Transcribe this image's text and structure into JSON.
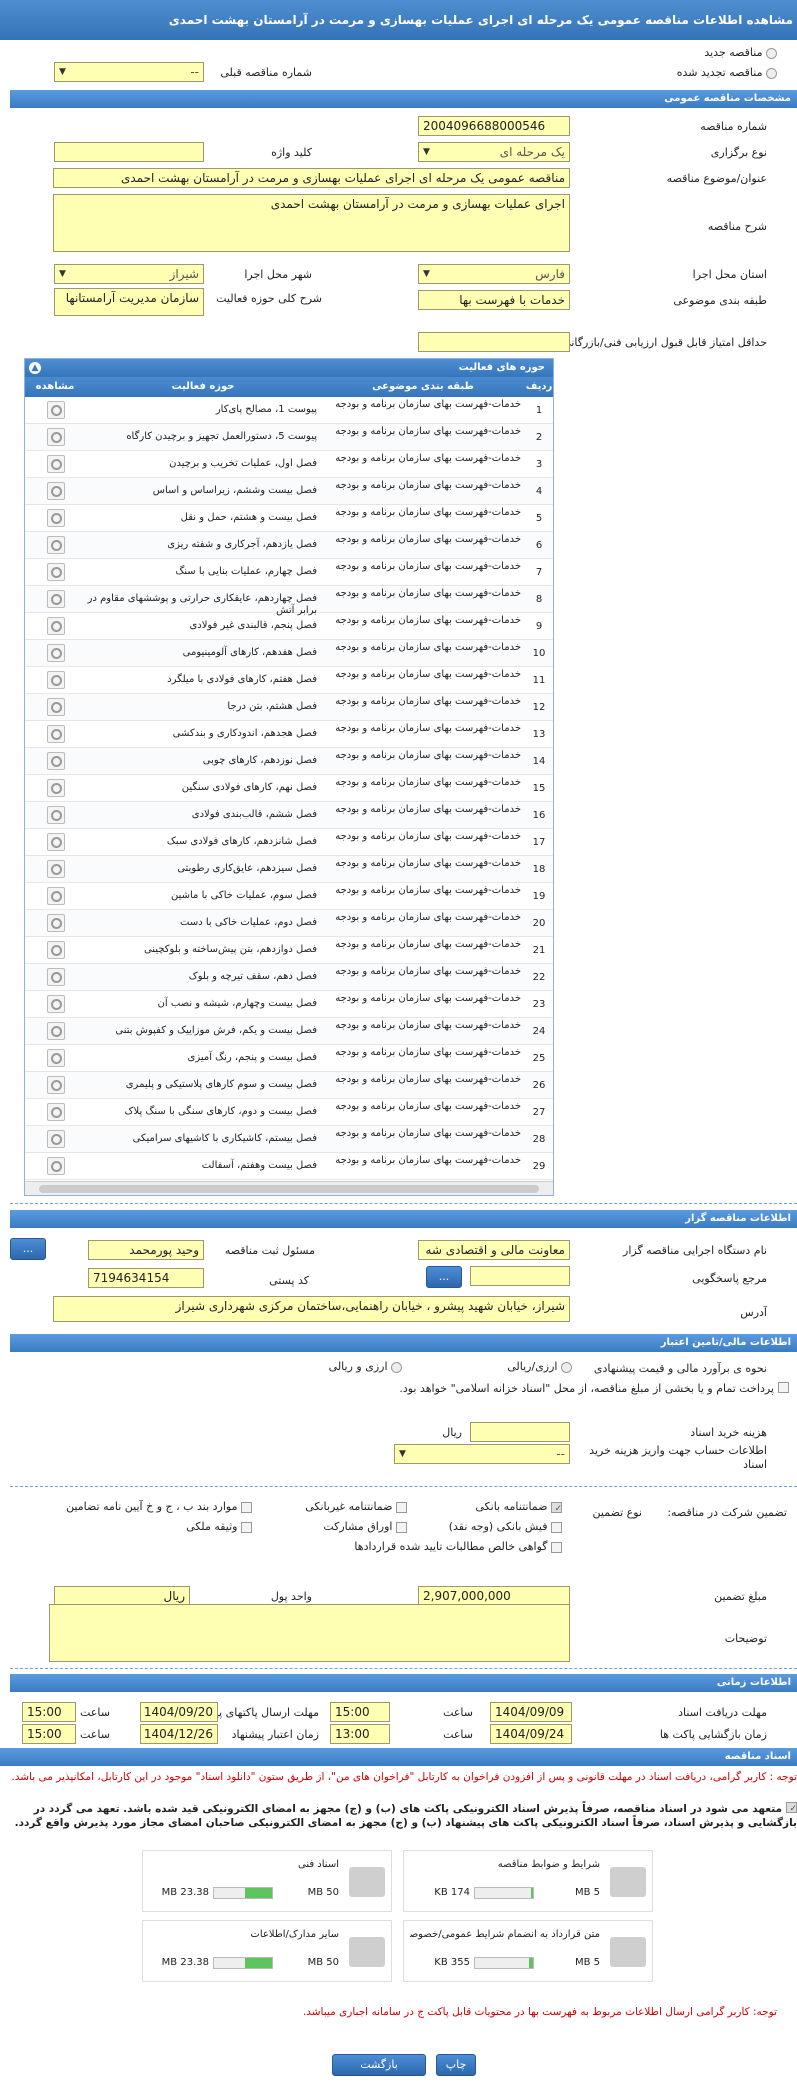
{
  "title": "مشاهده اطلاعات مناقصه عمومی یک مرحله ای اجرای عملیات بهسازی و مرمت در آرامستان بهشت احمدی",
  "top": {
    "new_tender": "مناقصه جدید",
    "renewed_tender": "مناقصه تجدید شده",
    "prev_number_label": "شماره مناقصه قبلی",
    "prev_number_value": "--"
  },
  "general": {
    "header": "مشخصات مناقصه عمومی",
    "number_label": "شماره مناقصه",
    "number_value": "2004096688000546",
    "type_label": "نوع برگزاری",
    "type_value": "یک مرحله ای",
    "keyword_label": "کلید واژه",
    "keyword_value": "",
    "subject_label": "عنوان/موضوع مناقصه",
    "subject_value": "مناقصه عمومی یک مرحله ای اجرای عملیات بهسازی و مرمت در آرامستان بهشت احمدی",
    "desc_label": "شرح مناقصه",
    "desc_value": "اجرای عملیات بهسازی و مرمت در آرامستان بهشت احمدی",
    "province_label": "استان محل اجرا",
    "province_value": "فارس",
    "city_label": "شهر محل اجرا",
    "city_value": "شیراز",
    "category_label": "طبقه بندی موضوعی",
    "category_value": "خدمات با فهرست بها",
    "activity_desc_label": "شرح کلی حوزه فعالیت",
    "activity_desc_value": "سازمان مدیریت آرامستانها",
    "min_score_label": "حداقل امتیاز قابل قبول ارزیابی فنی/بازرگانی",
    "min_score_value": ""
  },
  "grid": {
    "header": "حوزه های فعالیت",
    "col_row": "ردیف",
    "col_category": "طبقه بندی موضوعی",
    "col_activity": "حوزه فعالیت",
    "col_view": "مشاهده",
    "category_text": "خدمات-فهرست بهای سازمان برنامه و بودجه",
    "rows": [
      {
        "n": "1",
        "a": "پیوست 1، مصالح پای‌کار"
      },
      {
        "n": "2",
        "a": "پیوست 5، دستورالعمل تجهیز و برچیدن کارگاه"
      },
      {
        "n": "3",
        "a": "فصل اول، عملیات تخریب و برچیدن"
      },
      {
        "n": "4",
        "a": "فصل بیست وششم، زیراساس و اساس"
      },
      {
        "n": "5",
        "a": "فصل بیست و هشتم، حمل و نقل"
      },
      {
        "n": "6",
        "a": "فصل یازدهم، آجرکاری و شفته ریزی"
      },
      {
        "n": "7",
        "a": "فصل چهارم، عملیات بنایی با سنگ"
      },
      {
        "n": "8",
        "a": "فصل چهاردهم، عایقکاری حرارتی و پوششهای مقاوم در برابر آتش"
      },
      {
        "n": "9",
        "a": "فصل پنجم، قالبندی غیر فولادی"
      },
      {
        "n": "10",
        "a": "فصل هفدهم، کارهای آلومینیومی"
      },
      {
        "n": "11",
        "a": "فصل هفتم، کارهای فولادی با میلگرد"
      },
      {
        "n": "12",
        "a": "فصل هشتم، بتن درجا"
      },
      {
        "n": "13",
        "a": "فصل هجدهم، اندودکاری و بندکشی"
      },
      {
        "n": "14",
        "a": "فصل نوزدهم، کارهای چوبی"
      },
      {
        "n": "15",
        "a": "فصل نهم، کارهای فولادی سنگین"
      },
      {
        "n": "16",
        "a": "فصل ششم، قالب‌بندی فولادی"
      },
      {
        "n": "17",
        "a": "فصل شانزدهم، کارهای فولادی سبک"
      },
      {
        "n": "18",
        "a": "فصل سیزدهم، عایق‌کاری رطوبتی"
      },
      {
        "n": "19",
        "a": "فصل سوم، عملیات خاکی با ماشین"
      },
      {
        "n": "20",
        "a": "فصل دوم، عملیات خاکی با دست"
      },
      {
        "n": "21",
        "a": "فصل دوازدهم، بتن پیش‌ساخته و بلوکچینی"
      },
      {
        "n": "22",
        "a": "فصل دهم، سقف تیرچه و بلوک"
      },
      {
        "n": "23",
        "a": "فصل بیست وچهارم، شیشه و نصب آن"
      },
      {
        "n": "24",
        "a": "فصل بیست و یکم، فرش موزاییک و کفپوش بتنی"
      },
      {
        "n": "25",
        "a": "فصل بیست و پنجم، رنگ آمیزی"
      },
      {
        "n": "26",
        "a": "فصل بیست و سوم کارهای پلاستیکی و پلیمری"
      },
      {
        "n": "27",
        "a": "فصل بیست و دوم، کارهای سنگی با سنگ پلاک"
      },
      {
        "n": "28",
        "a": "فصل بیستم، کاشیکاری با کاشیهای سرامیکی"
      },
      {
        "n": "29",
        "a": "فصل بیست وهفتم، آسفالت"
      }
    ]
  },
  "organizer": {
    "header": "اطلاعات مناقصه گزار",
    "org_label": "نام دستگاه اجرایی مناقصه گزار",
    "org_value": "معاونت مالی و اقتصادی شه",
    "officer_label": "مسئول ثبت مناقصه",
    "officer_value": "وحید پورمحمد",
    "ref_label": "مرجع پاسخگویی",
    "ref_value": "",
    "postal_label": "کد پستی",
    "postal_value": "7194634154",
    "address_label": "آدرس",
    "address_value": "شیراز، خیابان شهید پیشرو ، خیابان راهنمایی،ساختمان مرکزی شهرداری شیراز",
    "more_btn": "..."
  },
  "finance": {
    "header": "اطلاعات مالی/تامین اعتبار",
    "estimate_label": "نحوه ی برآورد مالی و قیمت پیشنهادی",
    "opt1": "ارزی/ریالی",
    "opt2": "ارزی و ریالی",
    "treasury_text": "پرداخت تمام و یا بخشی از مبلغ مناقصه، از محل \"اسناد خزانه اسلامی\" خواهد بود.",
    "doc_fee_label": "هزینه خرید اسناد",
    "doc_fee_unit": "ریال",
    "account_label": "اطلاعات حساب جهت واریز هزینه خرید اسناد",
    "account_value": "--"
  },
  "guarantee": {
    "label": "تضمین شرکت در مناقصه:",
    "type_label": "نوع تضمین",
    "opts": [
      {
        "t": "ضمانتنامه بانکی",
        "on": true
      },
      {
        "t": "ضمانتنامه غیربانکی",
        "on": false
      },
      {
        "t": "موارد بند ب ، ج و خ آیین نامه تضامین",
        "on": false
      },
      {
        "t": "فیش بانکی (وجه نقد)",
        "on": false
      },
      {
        "t": "اوراق مشارکت",
        "on": false
      },
      {
        "t": "وثیقه ملکی",
        "on": false
      },
      {
        "t": "گواهی خالص مطالبات تایید شده قراردادها",
        "on": false
      }
    ],
    "amount_label": "مبلغ تضمین",
    "amount_value": "2,907,000,000",
    "currency_label": "واحد پول",
    "currency_value": "ریال",
    "notes_label": "توضیحات",
    "notes_value": ""
  },
  "time": {
    "header": "اطلاعات زمانی",
    "doc_deadline_label": "مهلت دریافت اسناد",
    "doc_deadline_date": "1404/09/09",
    "doc_deadline_time": "15:00",
    "send_deadline_label": "مهلت ارسال پاکتهای پیشنهاد",
    "send_deadline_date": "1404/09/20",
    "send_deadline_time": "15:00",
    "open_label": "زمان بازگشایی پاکت ها",
    "open_date": "1404/09/24",
    "open_time": "13:00",
    "validity_label": "زمان اعتبار پیشنهاد",
    "validity_date": "1404/12/26",
    "validity_time": "15:00",
    "hour_label": "ساعت"
  },
  "docs": {
    "header": "اسناد مناقصه",
    "notice1": "توجه : کاربر گرامی، دریافت اسناد در مهلت قانونی و پس از افزودن فراخوان به کارتابل \"فراخوان های من\"، از طریق ستون \"دانلود اسناد\" موجود در این کارتابل، امکانپذیر می باشد.",
    "commit": "متعهد می شود در اسناد مناقصه، صرفاً پذیرش اسناد الکترونیکی پاکت های (ب) و (ج) مجهز به امضای الکترونیکی قید شده باشد. تعهد می گردد در بازگشایی و پذیرش اسناد، صرفاً اسناد الکترونیکی پاکت های پیشنهاد (ب) و (ج) مجهز به امضای الکترونیکی صاحبان امضای مجاز مورد پذیرش واقع گردد.",
    "files": [
      {
        "name": "شرایط و ضوابط مناقصه",
        "size": "174 KB",
        "max": "5 MB",
        "pct": 4
      },
      {
        "name": "اسناد فنی",
        "size": "23.38 MB",
        "max": "50 MB",
        "pct": 47
      },
      {
        "name": "متن قرارداد به انضمام شرایط عمومی/خصوصی",
        "size": "355 KB",
        "max": "5 MB",
        "pct": 7
      },
      {
        "name": "سایر مدارک/اطلاعات",
        "size": "23.38 MB",
        "max": "50 MB",
        "pct": 47
      }
    ],
    "notice2": "توجه: کاربر گرامی ارسال اطلاعات مربوط به فهرست بها در محتویات قابل پاکت ج در سامانه اجباری میباشد.",
    "back_btn": "بازگشت",
    "print_btn": "چاپ"
  }
}
